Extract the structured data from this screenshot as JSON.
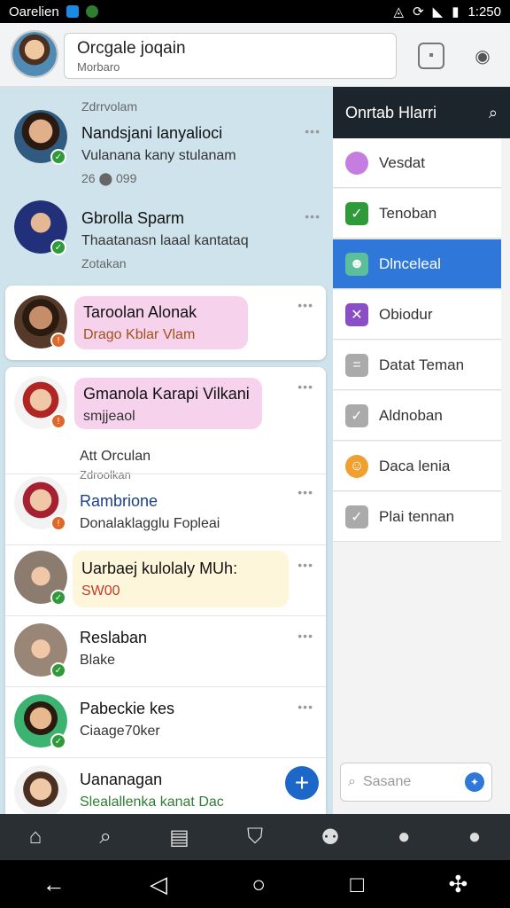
{
  "status": {
    "carrier": "Oarelien",
    "time": "1:250"
  },
  "header": {
    "title": "Orcgale joqain",
    "subtitle": "Morbaro"
  },
  "chats": [
    {
      "meta_top": "Zdrrvolam",
      "name": "Nandsjani lanyalioci",
      "msg": "Vulanana kany stulanam",
      "meta": "26 ⬤ 099"
    },
    {
      "name": "Gbrolla Sparm",
      "msg": "Thaatanasn laaal kantataq",
      "meta": "Zotakan"
    },
    {
      "name": "Taroolan Alonak",
      "msg": "Drago Kblar Vlam"
    },
    {
      "name": "Gmanola Karapi Vilkani",
      "msg": "smjjeaol"
    },
    {
      "meta_sub": "Att Orculan",
      "meta_top": "Zdroolkan",
      "name": "Rambrione",
      "msg": "Donalaklagglu Fopleai"
    },
    {
      "name": "Uarbaej kulolaly MUh:",
      "msg": "SW00"
    },
    {
      "name": "Reslaban",
      "msg": "Blake"
    },
    {
      "name": "Pabeckie kes",
      "msg": "Ciaage70ker"
    },
    {
      "name": "Uananagan",
      "msg": "Slealallenka kanat Dac"
    }
  ],
  "panel": {
    "title": "Onrtab Hlarri",
    "search_placeholder": "Sasane",
    "items": [
      {
        "label": "Vesdat",
        "icon": "person-icon"
      },
      {
        "label": "Tenoban",
        "icon": "check-icon"
      },
      {
        "label": "Dlnceleal",
        "icon": "alien-icon"
      },
      {
        "label": "Obiodur",
        "icon": "x-icon"
      },
      {
        "label": "Datat Teman",
        "icon": "equal-icon"
      },
      {
        "label": "Aldnoban",
        "icon": "check-icon"
      },
      {
        "label": "Daca lenia",
        "icon": "smile-icon"
      },
      {
        "label": "Plai tennan",
        "icon": "check-icon"
      }
    ]
  }
}
